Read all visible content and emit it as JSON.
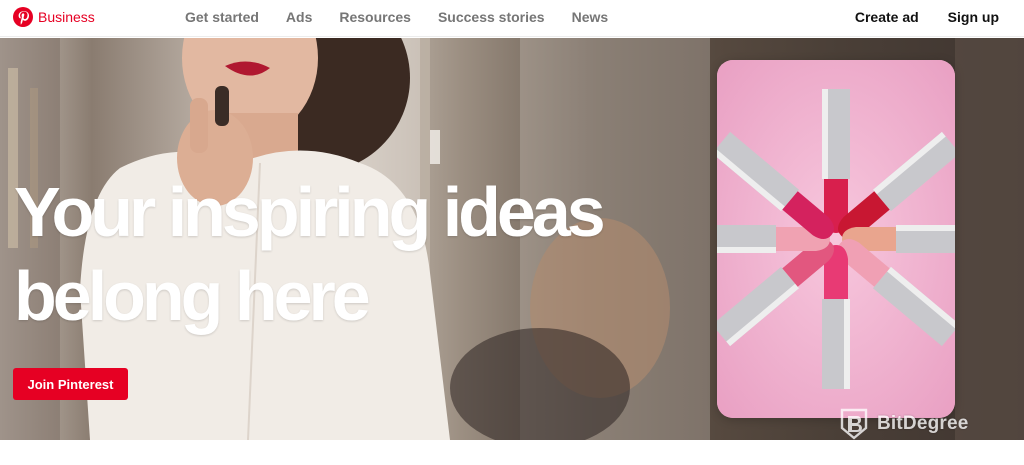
{
  "brand": {
    "name": "Business",
    "logo_icon": "pinterest-logo-icon",
    "color": "#e60023"
  },
  "nav": {
    "center_links": [
      "Get started",
      "Ads",
      "Resources",
      "Success stories",
      "News"
    ],
    "right_links": [
      "Create ad",
      "Sign up"
    ]
  },
  "hero": {
    "headline_line1": "Your inspiring ideas",
    "headline_line2": "belong here",
    "cta_label": "Join Pinterest",
    "cta_color": "#e60023",
    "image_left": "woman applying lipstick in mirror",
    "image_card": "lipsticks arranged in a circle on pink background"
  },
  "watermark": {
    "icon": "bitdegree-shield-icon",
    "text": "BitDegree"
  }
}
